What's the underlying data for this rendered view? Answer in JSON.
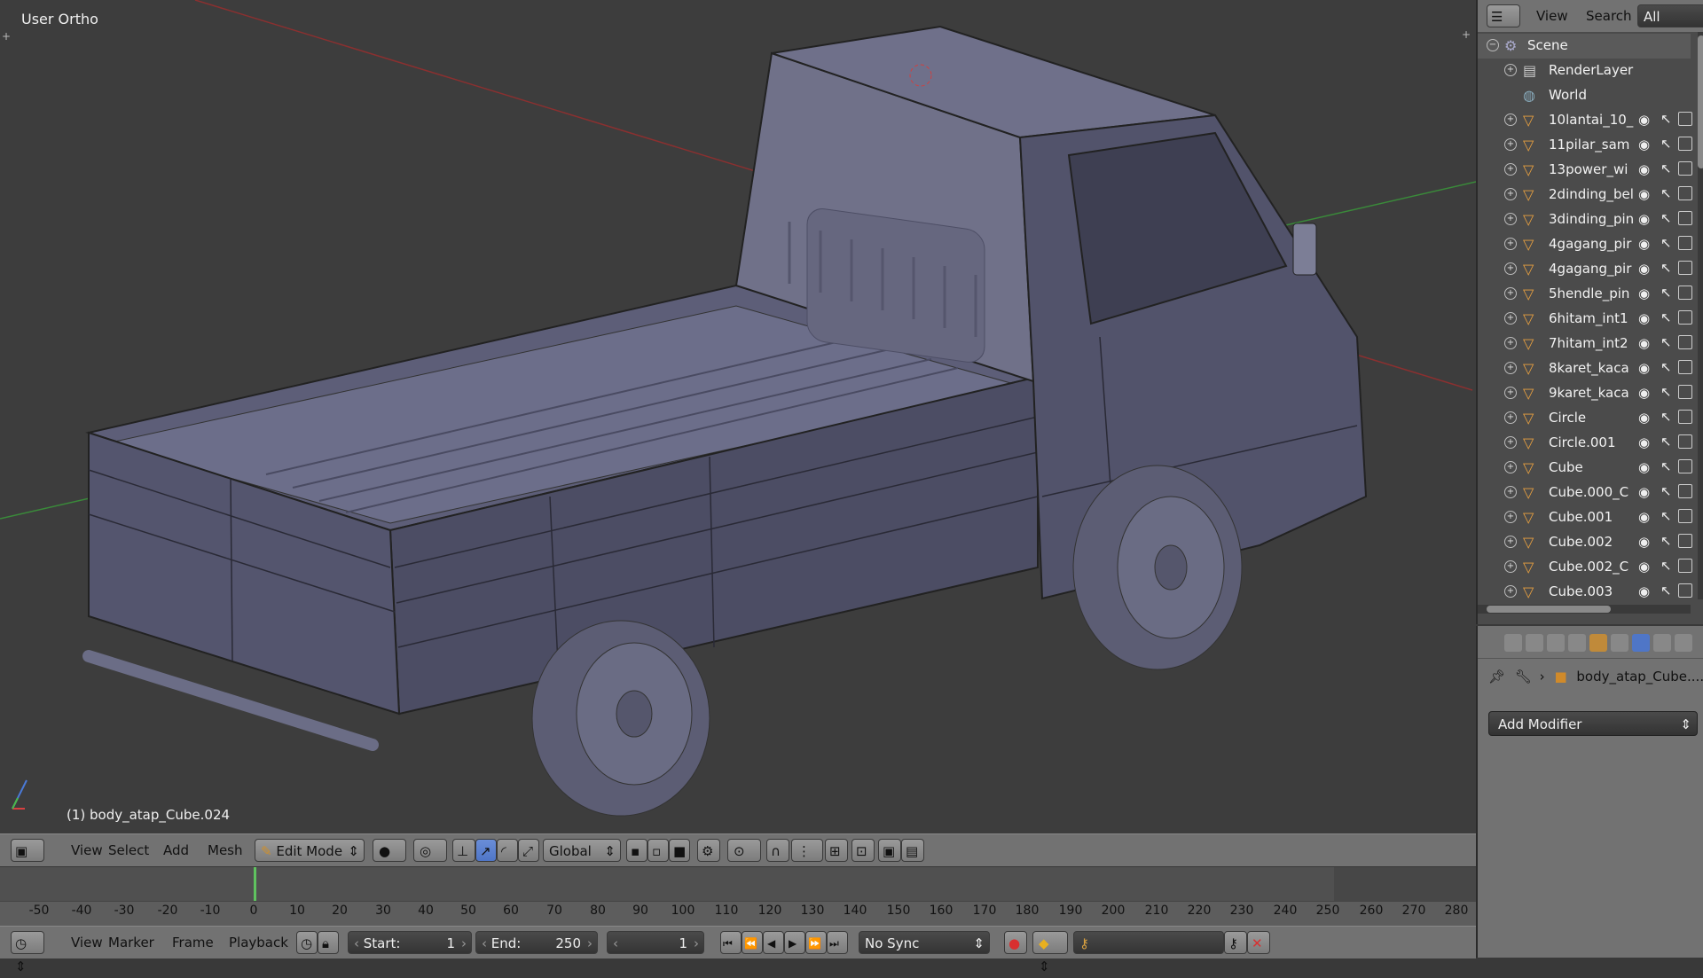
{
  "viewport": {
    "title": "User Ortho",
    "active_object": "(1) body_atap_Cube.024"
  },
  "view3d_header": {
    "menus": [
      "View",
      "Select",
      "Add",
      "Mesh"
    ],
    "mode": "Edit Mode",
    "orientation": "Global"
  },
  "timeline": {
    "ticks": [
      "-50",
      "-40",
      "-30",
      "-20",
      "-10",
      "0",
      "10",
      "20",
      "30",
      "40",
      "50",
      "60",
      "70",
      "80",
      "90",
      "100",
      "110",
      "120",
      "130",
      "140",
      "150",
      "160",
      "170",
      "180",
      "190",
      "200",
      "210",
      "220",
      "230",
      "240",
      "250",
      "260",
      "270",
      "280"
    ],
    "current_frame_marker": 1
  },
  "timeline_header": {
    "menus": [
      "View",
      "Marker",
      "Frame",
      "Playback"
    ],
    "start_label": "Start:",
    "start_value": "1",
    "end_label": "End:",
    "end_value": "250",
    "current_frame": "1",
    "sync": "No Sync"
  },
  "outliner": {
    "header": {
      "view": "View",
      "search": "Search",
      "scene_filter": "All Scenes"
    },
    "rows": [
      {
        "label": "Scene",
        "type": "scene"
      },
      {
        "label": "RenderLayers",
        "type": "renderlayer"
      },
      {
        "label": "World",
        "type": "world"
      },
      {
        "label": "10lantai_10_",
        "type": "object"
      },
      {
        "label": "11pilar_sam",
        "type": "object"
      },
      {
        "label": "13power_wi",
        "type": "object"
      },
      {
        "label": "2dinding_bel",
        "type": "object"
      },
      {
        "label": "3dinding_pin",
        "type": "object"
      },
      {
        "label": "4gagang_pir",
        "type": "object"
      },
      {
        "label": "4gagang_pir",
        "type": "object"
      },
      {
        "label": "5hendle_pin",
        "type": "object"
      },
      {
        "label": "6hitam_int1",
        "type": "object"
      },
      {
        "label": "7hitam_int2",
        "type": "object"
      },
      {
        "label": "8karet_kaca",
        "type": "object"
      },
      {
        "label": "9karet_kaca",
        "type": "object"
      },
      {
        "label": "Circle",
        "type": "object"
      },
      {
        "label": "Circle.001",
        "type": "object"
      },
      {
        "label": "Cube",
        "type": "object"
      },
      {
        "label": "Cube.000_C",
        "type": "object"
      },
      {
        "label": "Cube.001",
        "type": "object"
      },
      {
        "label": "Cube.002",
        "type": "object"
      },
      {
        "label": "Cube.002_C",
        "type": "object"
      },
      {
        "label": "Cube.003",
        "type": "object"
      }
    ]
  },
  "properties": {
    "object_name": "body_atap_Cube....",
    "add_modifier": "Add Modifier"
  },
  "colors": {
    "viewport_bg": "#3d3d3d",
    "header_bg": "#727272",
    "selected_tab": "#4f76c7",
    "timeline_cursor": "#5fc25f",
    "object_icon": "#e8a040"
  }
}
